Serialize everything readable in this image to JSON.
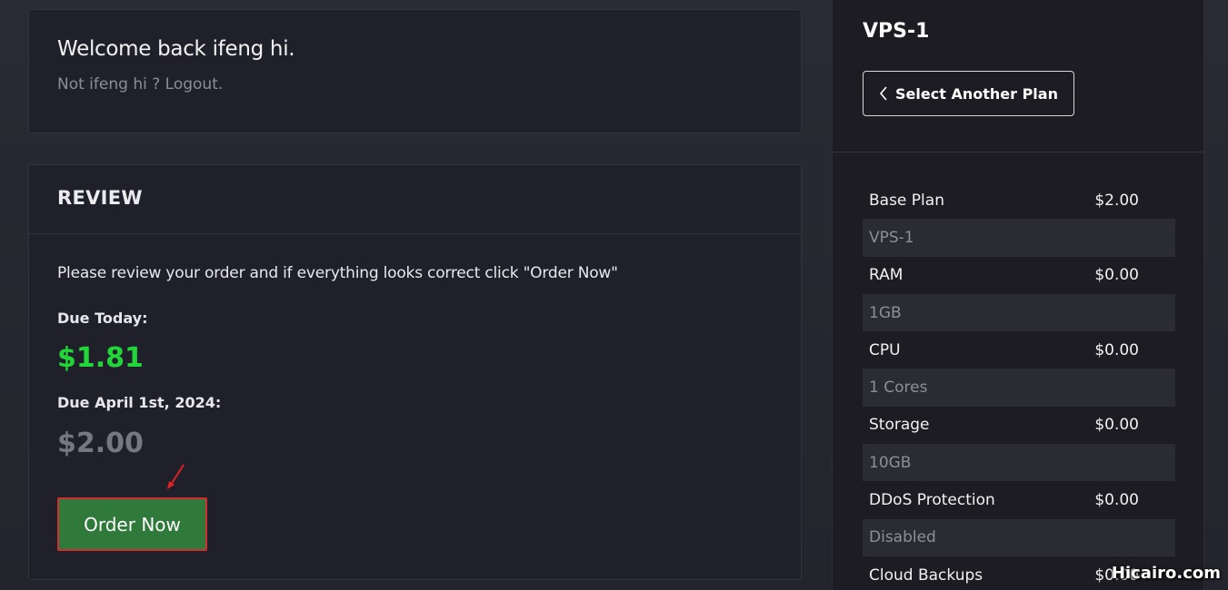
{
  "welcome": {
    "title": "Welcome back ifeng hi.",
    "not_user": "Not ifeng hi ?",
    "logout": "Logout."
  },
  "review": {
    "title": "REVIEW",
    "description": "Please review your order and if everything looks correct click \"Order Now\"",
    "due_today_label": "Due Today:",
    "due_today_amount": "$1.81",
    "due_later_label": "Due April 1st, 2024:",
    "due_later_amount": "$2.00",
    "order_button": "Order Now"
  },
  "sidebar": {
    "plan_name": "VPS-1",
    "select_button": "Select Another Plan",
    "items": [
      {
        "name": "Base Plan",
        "price": "$2.00",
        "value": "VPS-1"
      },
      {
        "name": "RAM",
        "price": "$0.00",
        "value": "1GB"
      },
      {
        "name": "CPU",
        "price": "$0.00",
        "value": "1 Cores"
      },
      {
        "name": "Storage",
        "price": "$0.00",
        "value": "10GB"
      },
      {
        "name": "DDoS Protection",
        "price": "$0.00",
        "value": "Disabled"
      },
      {
        "name": "Cloud Backups",
        "price": "$0.00",
        "value": ""
      }
    ]
  },
  "watermark": "Hicairo.com",
  "colors": {
    "due_today": "#22d63a",
    "order_button_bg": "#2f7a3a",
    "order_button_border": "#cf2f2f"
  },
  "icons": [
    "chevron-left-icon",
    "red-arrow-icon"
  ]
}
